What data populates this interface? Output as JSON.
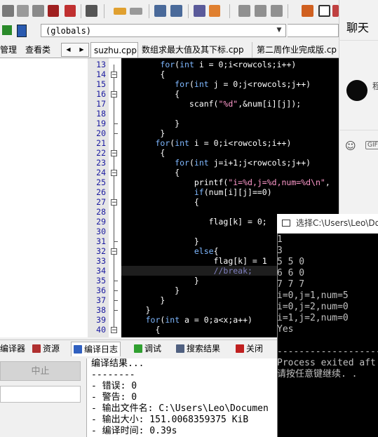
{
  "toolbar": {
    "icons": [
      "save-icon",
      "save-all-icon",
      "close-icon",
      "close-all-icon",
      "print-icon",
      "undo-icon",
      "redo-icon",
      "find-icon",
      "replace-icon",
      "indent-icon",
      "unindent-icon",
      "bookmark-icon",
      "toggle-icon",
      "goto-icon",
      "layout-icon",
      "window-icon",
      "grid-icon",
      "panel-icon",
      "user-icon"
    ]
  },
  "scope": {
    "value": "(globals)"
  },
  "left_tabs": {
    "manage": "管理",
    "view_class": "查看类"
  },
  "file_tabs": [
    "suzhu.cpp",
    "数组求最大值及其下标.cpp",
    "第二周作业完成版.cp"
  ],
  "editor": {
    "line_numbers": [
      "13",
      "14",
      "15",
      "16",
      "17",
      "18",
      "19",
      "20",
      "21",
      "22",
      "23",
      "24",
      "25",
      "26",
      "27",
      "28",
      "29",
      "30",
      "31",
      "32",
      "33",
      "34",
      "35",
      "36",
      "37",
      "38",
      "39",
      "40"
    ]
  },
  "bottom_tabs": {
    "compiler": "编译器",
    "resources": "资源",
    "compile_log": "编译日志",
    "debug": "调试",
    "search_results": "搜索结果",
    "close": "关闭"
  },
  "bottom_left": {
    "abort": "中止"
  },
  "compile_log": {
    "lines": [
      "编译结果...",
      "--------",
      "- 错误: 0",
      "- 警告: 0",
      "- 输出文件名: C:\\Users\\Leo\\Documen",
      "- 输出大小: 151.0068359375 KiB",
      "- 编译时间: 0.39s"
    ]
  },
  "chat": {
    "title": "聊天",
    "name": "程",
    "gif": "GIF"
  },
  "console": {
    "title": "选择C:\\Users\\Leo\\Do",
    "lines": [
      "1",
      "3",
      "5 5 0",
      "6 6 0",
      "7 7 7",
      "i=0,j=1,num=5",
      "i=0,j=2,num=0",
      "i=1,j=2,num=0",
      "Yes",
      "",
      "--------------------",
      "Process exited aft",
      "请按任意键继续. ."
    ]
  }
}
